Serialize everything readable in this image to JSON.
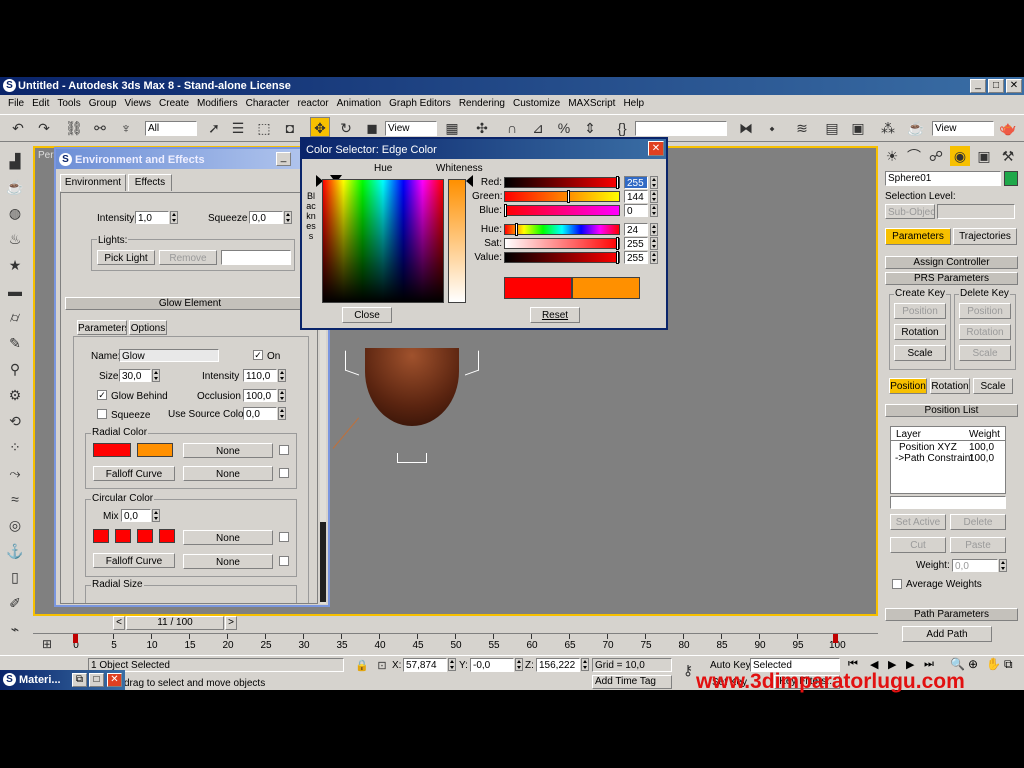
{
  "window": {
    "title": "Untitled - Autodesk 3ds Max 8  - Stand-alone License"
  },
  "menu": [
    "File",
    "Edit",
    "Tools",
    "Group",
    "Views",
    "Create",
    "Modifiers",
    "Character",
    "reactor",
    "Animation",
    "Graph Editors",
    "Rendering",
    "Customize",
    "MAXScript",
    "Help"
  ],
  "toolbar": {
    "selection_filter": "All",
    "ref_coord": "View",
    "view_dropdown": "View"
  },
  "viewport": {
    "label": "Pers",
    "bg": "#808080"
  },
  "env_dialog": {
    "title": "Environment and Effects",
    "tabs": [
      "Environment",
      "Effects"
    ],
    "intensity_label": "Intensity",
    "intensity_value": "1,0",
    "squeeze_label": "Squeeze",
    "squeeze_value": "0,0",
    "lights_label": "Lights:",
    "pick_light": "Pick Light",
    "remove": "Remove",
    "glow_header": "Glow Element",
    "sub_tabs": [
      "Parameters",
      "Options"
    ],
    "name_label": "Name:",
    "name_value": "Glow",
    "on_label": "On",
    "size_label": "Size",
    "size_value": "30,0",
    "intensity2_label": "Intensity",
    "intensity2_value": "110,0",
    "glow_behind": "Glow Behind",
    "occlusion_label": "Occlusion",
    "occlusion_value": "100,0",
    "squeeze2": "Squeeze",
    "use_source_label": "Use Source Color",
    "use_source_value": "0,0",
    "radial_color": "Radial Color",
    "none": "None",
    "falloff_curve": "Falloff Curve",
    "circular_color": "Circular Color",
    "mix_label": "Mix",
    "mix_value": "0,0",
    "radial_size": "Radial Size"
  },
  "color_selector": {
    "title": "Color Selector: Edge Color",
    "hue_label": "Hue",
    "whiteness_label": "Whiteness",
    "blackness_label": "Blackness",
    "rows": [
      {
        "label": "Red:",
        "value": "255"
      },
      {
        "label": "Green:",
        "value": "144"
      },
      {
        "label": "Blue:",
        "value": "0"
      },
      {
        "label": "Hue:",
        "value": "24"
      },
      {
        "label": "Sat:",
        "value": "255"
      },
      {
        "label": "Value:",
        "value": "255"
      }
    ],
    "close": "Close",
    "reset": "Reset",
    "old_color": "#ff0000",
    "new_color": "#ff9000"
  },
  "command_panel": {
    "object_name": "Sphere01",
    "object_color": "#1fa84a",
    "selection_level": "Selection Level:",
    "sub_object": "Sub-Object",
    "tabs": [
      "Parameters",
      "Trajectories"
    ],
    "assign_controller": "Assign Controller",
    "prs_parameters": "PRS Parameters",
    "create_key": "Create Key",
    "delete_key": "Delete Key",
    "position": "Position",
    "rotation": "Rotation",
    "scale": "Scale",
    "position_list": "Position List",
    "layer_header": "Layer",
    "weight_header": "Weight",
    "layers": [
      {
        "name": "Position XYZ",
        "weight": "100,0"
      },
      {
        "name": "->Path Constraint",
        "weight": "100,0"
      }
    ],
    "set_active": "Set Active",
    "delete": "Delete",
    "cut": "Cut",
    "paste": "Paste",
    "weight_label": "Weight:",
    "weight_value": "0,0",
    "average_weights": "Average Weights",
    "path_parameters": "Path Parameters",
    "add_path": "Add Path"
  },
  "timeline": {
    "slider": "11 / 100",
    "ticks": [
      "0",
      "5",
      "10",
      "15",
      "20",
      "25",
      "30",
      "35",
      "40",
      "45",
      "50",
      "55",
      "60",
      "65",
      "70",
      "75",
      "80",
      "85",
      "90",
      "95",
      "100"
    ]
  },
  "status": {
    "objects_selected": "1 Object Selected",
    "prompt": "drag to select and move objects",
    "x_label": "X:",
    "x_value": "57,874",
    "y_label": "Y:",
    "y_value": "-0,0",
    "z_label": "Z:",
    "z_value": "156,222",
    "grid": "Grid = 10,0",
    "add_time_tag": "Add Time Tag",
    "auto_key": "Auto Key",
    "set_key": "Set Key",
    "selected": "Selected",
    "key_filters": "Key Filters...",
    "watermark": "www.3dimparatorlugu.com"
  },
  "taskbar": {
    "item": "Materi..."
  }
}
